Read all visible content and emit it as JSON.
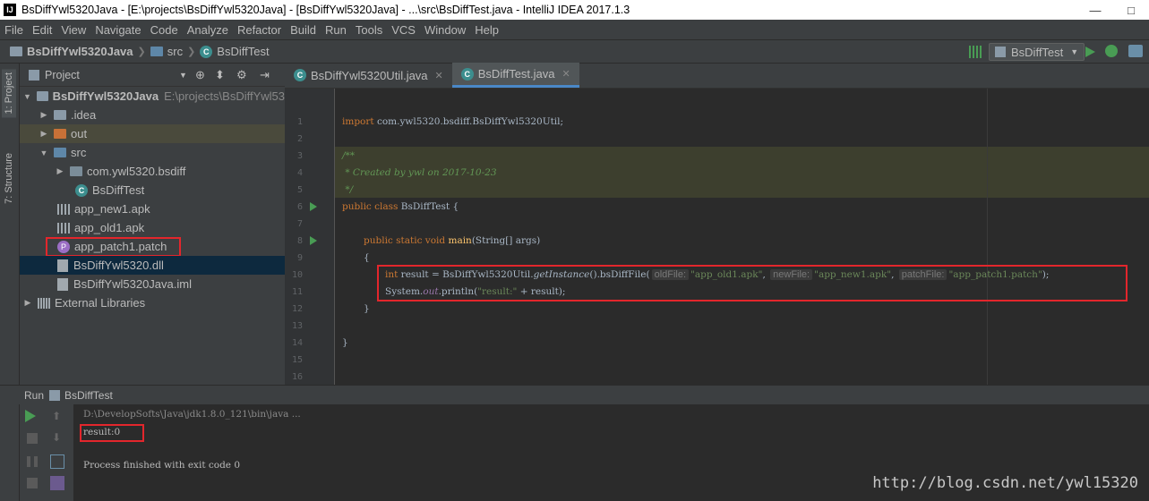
{
  "window": {
    "title": "BsDiffYwl5320Java - [E:\\projects\\BsDiffYwl5320Java] - [BsDiffYwl5320Java] - ...\\src\\BsDiffTest.java - IntelliJ IDEA 2017.1.3",
    "app_icon": "IJ"
  },
  "menu": [
    "File",
    "Edit",
    "View",
    "Navigate",
    "Code",
    "Analyze",
    "Refactor",
    "Build",
    "Run",
    "Tools",
    "VCS",
    "Window",
    "Help"
  ],
  "breadcrumb": [
    "BsDiffYwl5320Java",
    "src",
    "BsDiffTest"
  ],
  "run_config": "BsDiffTest",
  "side_tabs": [
    "1: Project",
    "7: Structure"
  ],
  "project_panel": {
    "title": "Project",
    "tree": [
      {
        "label": "BsDiffYwl5320Java",
        "path": "E:\\projects\\BsDiffYwl53",
        "icon": "folder-icon",
        "arrow": "▼"
      },
      {
        "label": ".idea",
        "icon": "folder-icon",
        "arrow": "▶"
      },
      {
        "label": "out",
        "icon": "folder-orange-icon",
        "arrow": "▶"
      },
      {
        "label": "src",
        "icon": "folder-blue-icon",
        "arrow": "▼"
      },
      {
        "label": "com.ywl5320.bsdiff",
        "icon": "package-icon",
        "arrow": "▶"
      },
      {
        "label": "BsDiffTest",
        "icon": "class-icon",
        "arrow": ""
      },
      {
        "label": "app_new1.apk",
        "icon": "apk-icon",
        "arrow": ""
      },
      {
        "label": "app_old1.apk",
        "icon": "apk-icon",
        "arrow": ""
      },
      {
        "label": "app_patch1.patch",
        "icon": "patch-icon",
        "arrow": ""
      },
      {
        "label": "BsDiffYwl5320.dll",
        "icon": "dll-icon",
        "arrow": ""
      },
      {
        "label": "BsDiffYwl5320Java.iml",
        "icon": "iml-icon",
        "arrow": ""
      },
      {
        "label": "External Libraries",
        "icon": "libraries-icon",
        "arrow": "▶"
      }
    ]
  },
  "editor": {
    "tabs": [
      {
        "label": "BsDiffYwl5320Util.java"
      },
      {
        "label": "BsDiffTest.java"
      }
    ],
    "line_numbers": [
      "1",
      "2",
      "3",
      "4",
      "5",
      "6",
      "7",
      "8",
      "9",
      "10",
      "11",
      "12",
      "13",
      "14",
      "15",
      "16"
    ],
    "code": {
      "l1_kw": "import",
      "l1_rest": " com.ywl5320.bsdiff.BsDiffYwl5320Util;",
      "l3": "/**",
      "l4": " * Created by ywl on 2017-10-23",
      "l5": " */",
      "l6_kw": "public class",
      "l6_rest": " BsDiffTest {",
      "l8_kw": "public static void",
      "l8_method": "main",
      "l8_rest": "(String[] args)",
      "l9": "{",
      "l10_kw": "int",
      "l10_a": " result = BsDiffYwl5320Util.",
      "l10_method": "getInstance",
      "l10_b": "().bsDiffFile(",
      "l10_hint1": "oldFile:",
      "l10_s1": "\"app_old1.apk\"",
      "l10_hint2": "newFile:",
      "l10_s2": "\"app_new1.apk\"",
      "l10_hint3": "patchFile:",
      "l10_s3": "\"app_patch1.patch\"",
      "l10_end": ");",
      "l11_a": "System.",
      "l11_field": "out",
      "l11_b": ".println(",
      "l11_str": "\"result:\"",
      "l11_c": " + result);",
      "l12": "}",
      "l14": "}"
    }
  },
  "run_panel": {
    "header_label": "Run",
    "config_name": "BsDiffTest",
    "console": {
      "command": "D:\\DevelopSofts\\Java\\jdk1.8.0_121\\bin\\java ...",
      "result": "result:0",
      "finished": "Process finished with exit code 0"
    }
  },
  "watermark": "http://blog.csdn.net/ywl15320",
  "colors": {
    "accent": "#4a88c7",
    "highlight_box": "#e3262c",
    "run_green": "#499c54"
  }
}
